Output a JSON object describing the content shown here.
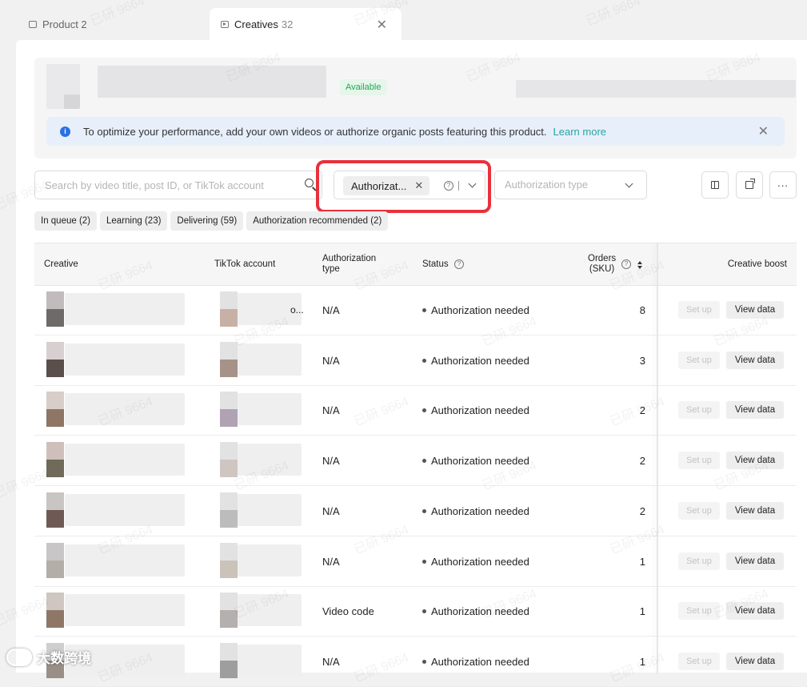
{
  "tabs": [
    {
      "label": "Product 2",
      "count": "",
      "icon": "box-icon"
    },
    {
      "label": "Creatives",
      "count": "32",
      "icon": "video-icon"
    }
  ],
  "product": {
    "badge": "Available"
  },
  "banner": {
    "message": "To optimize your performance, add your own videos or authorize organic posts featuring this product.",
    "link": "Learn more"
  },
  "search": {
    "placeholder": "Search by video title, post ID, or TikTok account"
  },
  "filter": {
    "chip_label": "Authorizat..."
  },
  "auth_type_select": {
    "placeholder": "Authorization type"
  },
  "status_pills": [
    "In queue (2)",
    "Learning (23)",
    "Delivering (59)",
    "Authorization recommended (2)"
  ],
  "table": {
    "headers": {
      "creative": "Creative",
      "account": "TikTok account",
      "auth_type_line1": "Authorization",
      "auth_type_line2": "type",
      "status": "Status",
      "orders_line1": "Orders",
      "orders_line2": "(SKU)",
      "boost": "Creative boost"
    },
    "setup_label": "Set up",
    "view_label": "View data",
    "rows": [
      {
        "auth_type": "N/A",
        "status": "Authorization needed",
        "orders": "8",
        "account_suffix": "o..."
      },
      {
        "auth_type": "N/A",
        "status": "Authorization needed",
        "orders": "3",
        "account_suffix": ""
      },
      {
        "auth_type": "N/A",
        "status": "Authorization needed",
        "orders": "2",
        "account_suffix": ""
      },
      {
        "auth_type": "N/A",
        "status": "Authorization needed",
        "orders": "2",
        "account_suffix": ""
      },
      {
        "auth_type": "N/A",
        "status": "Authorization needed",
        "orders": "2",
        "account_suffix": ""
      },
      {
        "auth_type": "N/A",
        "status": "Authorization needed",
        "orders": "1",
        "account_suffix": ""
      },
      {
        "auth_type": "Video code",
        "status": "Authorization needed",
        "orders": "1",
        "account_suffix": ""
      },
      {
        "auth_type": "N/A",
        "status": "Authorization needed",
        "orders": "1",
        "account_suffix": ""
      }
    ]
  },
  "watermark_text": "已研 9664",
  "logo_text": "大数跨境",
  "colors": {
    "highlight": "#e8313c",
    "link": "#2aa5a0",
    "available_green": "#21a655",
    "info_blue": "#2b6fe4"
  }
}
